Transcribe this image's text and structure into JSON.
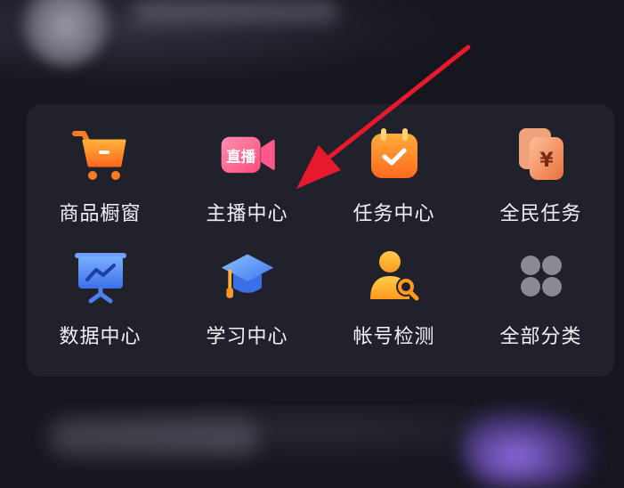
{
  "menu": {
    "items": [
      {
        "label": "商品橱窗",
        "icon": "shopping-cart-icon"
      },
      {
        "label": "主播中心",
        "icon": "live-camera-icon",
        "badge": "直播"
      },
      {
        "label": "任务中心",
        "icon": "calendar-check-icon"
      },
      {
        "label": "全民任务",
        "icon": "yuan-cards-icon",
        "symbol": "¥"
      },
      {
        "label": "数据中心",
        "icon": "chart-board-icon"
      },
      {
        "label": "学习中心",
        "icon": "graduation-cap-icon"
      },
      {
        "label": "帐号检测",
        "icon": "user-search-icon"
      },
      {
        "label": "全部分类",
        "icon": "grid-dots-icon"
      }
    ]
  },
  "colors": {
    "background": "#16161f",
    "panel": "#20212b",
    "label": "#f2f2f5",
    "arrow": "#e8192c",
    "orange": "#ff8a2a",
    "pink": "#ff5a8a",
    "blue": "#4f8dff",
    "gray": "#8a8a94"
  }
}
